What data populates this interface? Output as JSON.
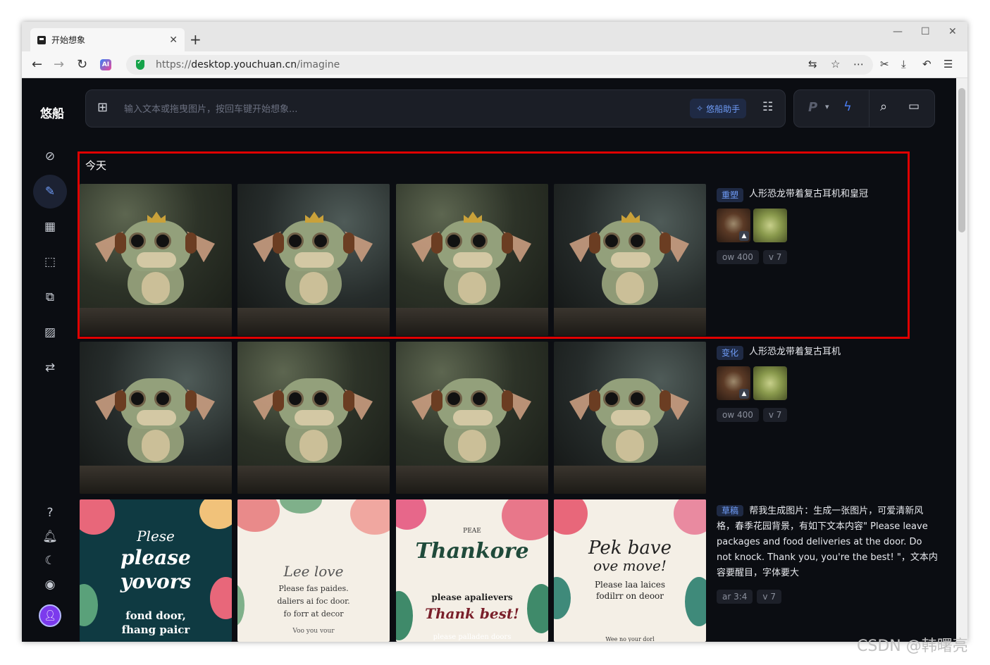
{
  "browser": {
    "tab_title": "开始想象",
    "url_prefix": "https://",
    "url_host": "desktop.youchuan.cn",
    "url_path": "/imagine",
    "ai_badge": "AI",
    "icons": [
      "back-icon",
      "forward-icon",
      "reload-icon",
      "translate-icon",
      "star-icon",
      "more-icon",
      "cut-icon",
      "download-icon",
      "undo-icon",
      "menu-icon"
    ]
  },
  "app": {
    "logo": "悠船",
    "prompt_placeholder": "输入文本或拖曳图片，按回车键开始想象...",
    "assistant_label": "悠船助手",
    "mode_label": "P",
    "sidebar_icons": [
      "compass-icon",
      "paint-icon",
      "grid-icon",
      "edit-icon",
      "copy-icon",
      "texture-icon",
      "chat-icon"
    ],
    "bottom_icons": [
      "help-icon",
      "bell-icon",
      "moon-icon",
      "user-icon",
      "avatar"
    ]
  },
  "feed": {
    "day_label": "今天",
    "jobs": [
      {
        "tag": "重塑",
        "prompt": "人形恐龙带着复古耳机和皇冠",
        "params": [
          "ow 400",
          "v 7"
        ]
      },
      {
        "tag": "变化",
        "prompt": "人形恐龙带着复古耳机",
        "params": [
          "ow 400",
          "v 7"
        ]
      },
      {
        "tag": "草稿",
        "prompt": "帮我生成图片：生成一张图片，可爱清新风格，春季花园背景，有如下文本内容\" Please leave packages and food deliveries at the door. Do not knock. Thank you, you're the best! \"，文本内容要醒目，字体要大",
        "params": [
          "ar 3:4",
          "v 7"
        ]
      }
    ],
    "posters": [
      {
        "l1": "Plese",
        "l2": "please",
        "l3": "yovors",
        "l4": "fond door,",
        "l5": "fhang paicr"
      },
      {
        "l1": "Lee love",
        "l2": "Please fas paides.",
        "l3": "daliers ai foc door.",
        "l4": "fo forr at decor",
        "l5": "Voo you vour"
      },
      {
        "l1": "PEAE",
        "l2": "Thankore",
        "l3": "please apalievers",
        "l4": "Thank best!",
        "l5": "please palladen doors"
      },
      {
        "l1": "Pek bave",
        "l2": "ove move!",
        "l3": "Please laa laices",
        "l4": "fodilrr on deoor",
        "l5": "Wee no your dorl"
      }
    ]
  },
  "watermark": "CSDN @韩曙亮",
  "colors": {
    "app_bg": "#0b0d12",
    "accent": "#6f9cf7",
    "highlight": "#e00000"
  }
}
